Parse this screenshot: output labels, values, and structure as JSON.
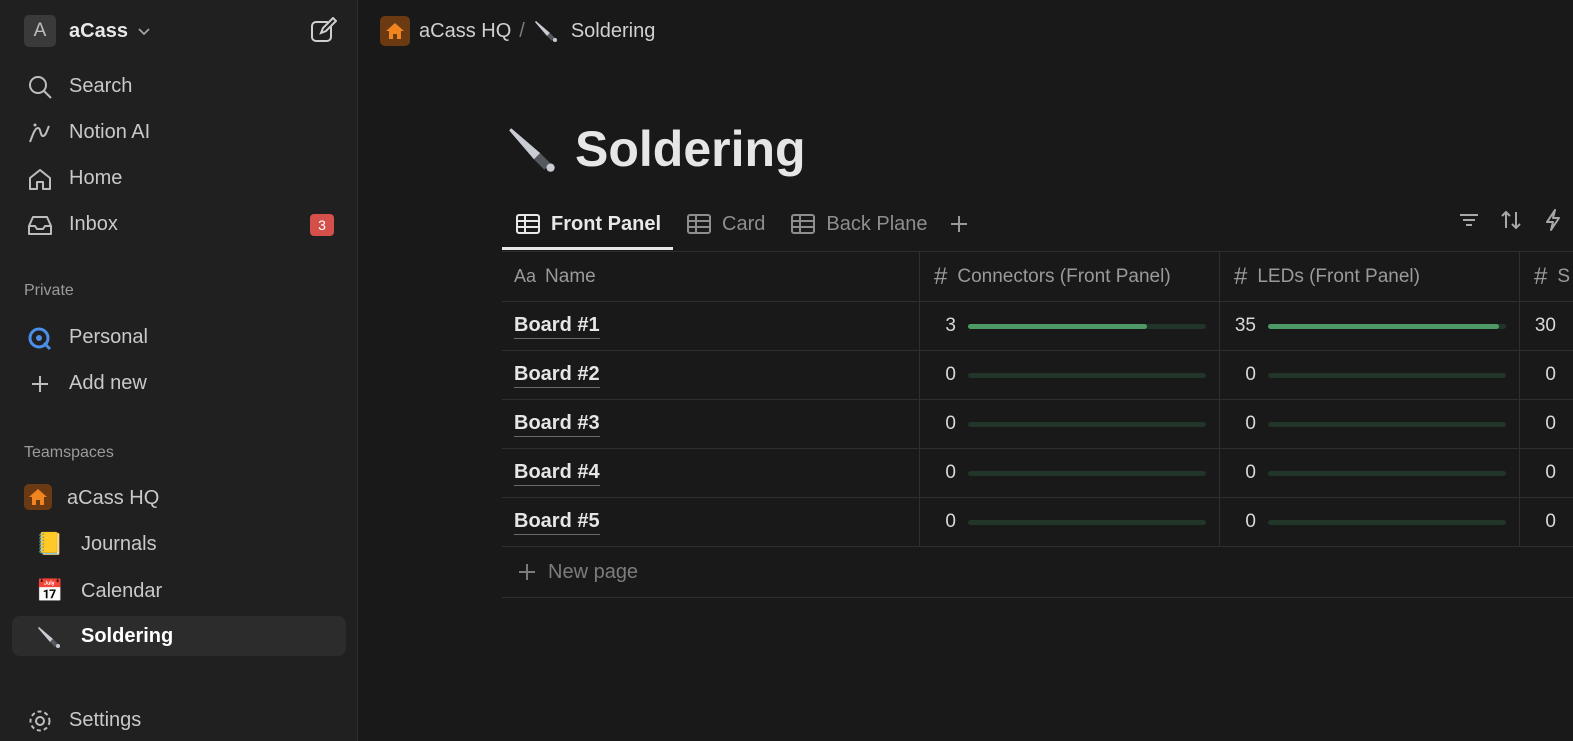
{
  "workspace": {
    "initial": "A",
    "name": "aCass"
  },
  "sidebar": {
    "nav": [
      {
        "label": "Search",
        "icon": "search-icon"
      },
      {
        "label": "Notion AI",
        "icon": "notion-ai-icon"
      },
      {
        "label": "Home",
        "icon": "home-icon"
      },
      {
        "label": "Inbox",
        "icon": "inbox-icon",
        "badge": "3"
      }
    ],
    "private_label": "Private",
    "private": [
      {
        "label": "Personal",
        "icon": "personal-icon"
      },
      {
        "label": "Add new",
        "icon": "plus-icon"
      }
    ],
    "teamspaces_label": "Teamspaces",
    "teamspace": {
      "label": "aCass HQ",
      "icon": "house-icon"
    },
    "pages": [
      {
        "label": "Journals",
        "icon": "notebook-icon",
        "emoji": "📒"
      },
      {
        "label": "Calendar",
        "icon": "calendar-icon",
        "emoji": "📅"
      },
      {
        "label": "Soldering",
        "icon": "pen-icon"
      }
    ],
    "settings": {
      "label": "Settings",
      "icon": "gear-icon"
    }
  },
  "breadcrumb": {
    "root": "aCass HQ",
    "separator": "/",
    "current": "Soldering"
  },
  "page": {
    "title": "Soldering"
  },
  "tabs": [
    {
      "label": "Front Panel",
      "active": true
    },
    {
      "label": "Card",
      "active": false
    },
    {
      "label": "Back Plane",
      "active": false
    }
  ],
  "table": {
    "columns": [
      {
        "prefix": "Aa",
        "label": "Name"
      },
      {
        "prefix": "#",
        "label": "Connectors (Front Panel)"
      },
      {
        "prefix": "#",
        "label": "LEDs (Front Panel)"
      },
      {
        "prefix": "#",
        "label": "S"
      }
    ],
    "rows": [
      {
        "name": "Board #1",
        "connectors": "3",
        "connectors_progress": 0.75,
        "leds": "35",
        "leds_progress": 0.97,
        "last": "30"
      },
      {
        "name": "Board #2",
        "connectors": "0",
        "connectors_progress": 0,
        "leds": "0",
        "leds_progress": 0,
        "last": "0"
      },
      {
        "name": "Board #3",
        "connectors": "0",
        "connectors_progress": 0,
        "leds": "0",
        "leds_progress": 0,
        "last": "0"
      },
      {
        "name": "Board #4",
        "connectors": "0",
        "connectors_progress": 0,
        "leds": "0",
        "leds_progress": 0,
        "last": "0"
      },
      {
        "name": "Board #5",
        "connectors": "0",
        "connectors_progress": 0,
        "leds": "0",
        "leds_progress": 0,
        "last": "0"
      }
    ],
    "new_page_label": "New page"
  },
  "colors": {
    "progress_fill": "#4d9a66",
    "badge": "#d5504a",
    "house_bg": "#6b3a12"
  }
}
